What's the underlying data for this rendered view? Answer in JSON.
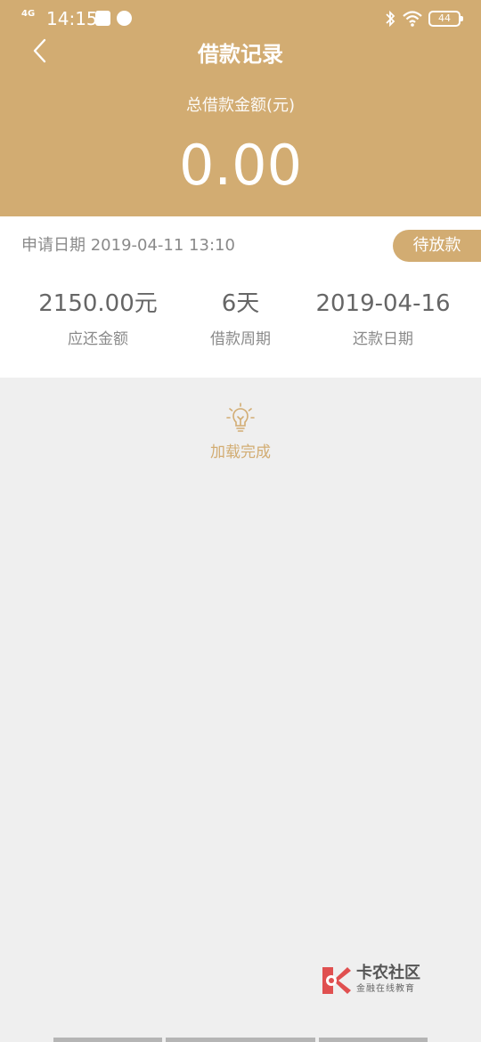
{
  "status_bar": {
    "network": "4G",
    "time": "14:15",
    "battery": "44"
  },
  "header": {
    "title": "借款记录",
    "total_label": "总借款金额(元)",
    "total_amount": "0.00"
  },
  "record": {
    "apply_date": "申请日期 2019-04-11 13:10",
    "status": "待放款",
    "stats": [
      {
        "value": "2150.00元",
        "label": "应还金额"
      },
      {
        "value": "6天",
        "label": "借款周期"
      },
      {
        "value": "2019-04-16",
        "label": "还款日期"
      }
    ]
  },
  "footer": {
    "loaded_text": "加载完成"
  },
  "watermark": {
    "title": "卡农社区",
    "subtitle": "金融在线教育"
  },
  "colors": {
    "accent": "#d2ac72",
    "background": "#efefef"
  },
  "icons": {
    "back": "back-arrow-icon",
    "bulb": "lightbulb-icon"
  }
}
